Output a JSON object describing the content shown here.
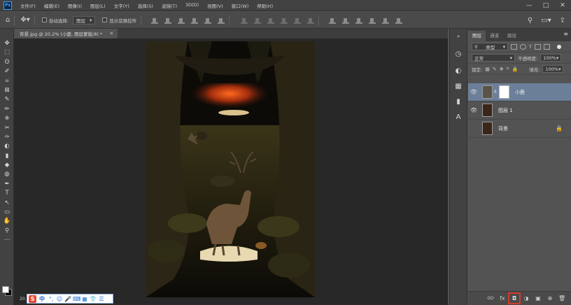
{
  "app": {
    "logo": "Ps",
    "menu": [
      "文件(F)",
      "编辑(E)",
      "图像(I)",
      "图层(L)",
      "文字(Y)",
      "选择(S)",
      "滤镜(T)",
      "3D(D)",
      "视图(V)",
      "窗口(W)",
      "帮助(H)"
    ],
    "window_controls": [
      "—",
      "□",
      "✕"
    ]
  },
  "options_bar": {
    "auto_select_label": "自动选择:",
    "auto_select_target": "图层",
    "transform_controls_label": "显示变换控件",
    "right_icons": [
      "search-icon",
      "workspace-icon",
      "share-icon"
    ]
  },
  "document": {
    "tab_title": "背景.jpg @ 20.2% (小鹿, 图层蒙版/8) *",
    "zoom": "20.2%"
  },
  "toolbox": {
    "tools": [
      "✥",
      "⬚",
      "ʘ",
      "✐",
      "⌗",
      "⊠",
      "✎",
      "✏",
      "⎈",
      "✂",
      "✑",
      "◐",
      "▮",
      "◆",
      "◍",
      "✒",
      "T",
      "↖",
      "▭",
      "✋",
      "⚲",
      "⋯"
    ],
    "foreground_color": "#ffffff",
    "background_color": "#000000"
  },
  "ime": {
    "logo": "S",
    "lang": "中",
    "icons": [
      "°,",
      "☺",
      "🎤",
      "⌨",
      "▦",
      "👕",
      "☰"
    ]
  },
  "layers_panel": {
    "tabs": [
      "图层",
      "通道",
      "路径"
    ],
    "active_tab": "图层",
    "filter_kind": "类型",
    "blend_mode": "正常",
    "opacity_label": "不透明度:",
    "opacity": "100%",
    "lock_label": "锁定:",
    "fill_label": "填充:",
    "fill": "100%",
    "layers": [
      {
        "name": "小鹿",
        "visible": true,
        "selected": true,
        "has_mask": true,
        "thumb": "deer",
        "locked": false
      },
      {
        "name": "图层 1",
        "visible": true,
        "selected": false,
        "has_mask": false,
        "thumb": "dark",
        "locked": false
      },
      {
        "name": "背景",
        "visible": false,
        "selected": false,
        "has_mask": false,
        "thumb": "dark",
        "locked": true
      }
    ],
    "footer_icons": [
      "GO",
      "fx",
      "◘",
      "◑",
      "▣",
      "⊕",
      "🗑"
    ]
  },
  "colors": {
    "selection": "#6c7f99",
    "highlight_box": "#d23b2b",
    "ps_blue": "#31a8ff"
  }
}
